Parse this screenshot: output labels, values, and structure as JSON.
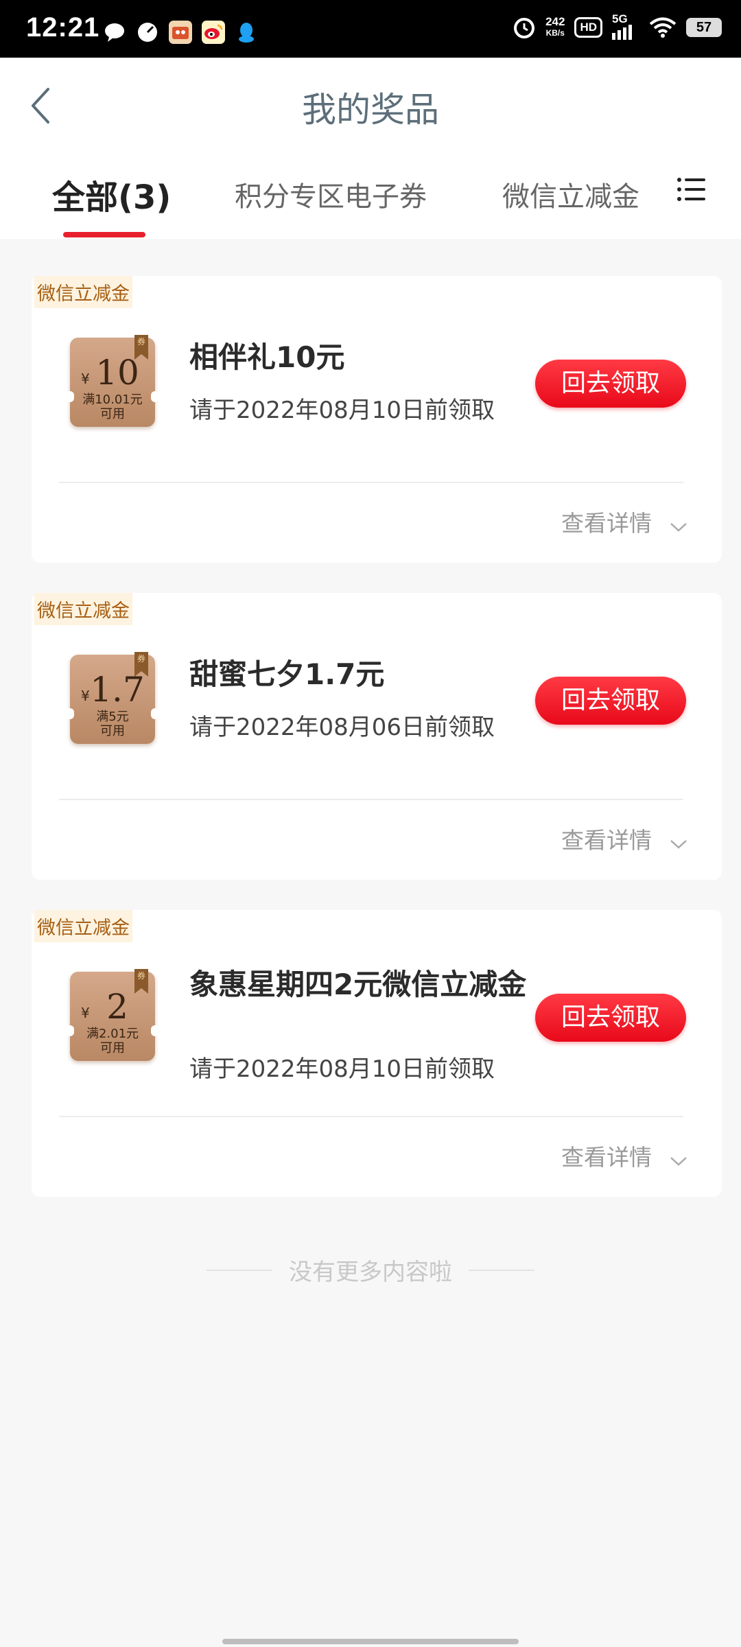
{
  "status_bar": {
    "time": "12:21",
    "speed_value": "242",
    "speed_unit": "KB/s",
    "hd": "HD",
    "network": "5G",
    "battery": "57"
  },
  "header": {
    "title": "我的奖品"
  },
  "tabs": [
    {
      "label": "全部(3)"
    },
    {
      "label": "积分专区电子券"
    },
    {
      "label": "微信立减金("
    }
  ],
  "prizes": [
    {
      "tag": "微信立减金",
      "coupon": {
        "currency": "¥",
        "amount": "10",
        "condition_line1": "满10.01元",
        "condition_line2": "可用",
        "ribbon": "券"
      },
      "name": "相伴礼10元",
      "deadline": "请于2022年08月10日前领取",
      "claim_label": "回去领取",
      "details_label": "查看详情"
    },
    {
      "tag": "微信立减金",
      "coupon": {
        "currency": "¥",
        "amount": "1.7",
        "condition_line1": "满5元",
        "condition_line2": "可用",
        "ribbon": "券"
      },
      "name": "甜蜜七夕1.7元",
      "deadline": "请于2022年08月06日前领取",
      "claim_label": "回去领取",
      "details_label": "查看详情"
    },
    {
      "tag": "微信立减金",
      "coupon": {
        "currency": "¥",
        "amount": "2",
        "condition_line1": "满2.01元",
        "condition_line2": "可用",
        "ribbon": "券"
      },
      "name": "象惠星期四2元微信立减金",
      "deadline": "请于2022年08月10日前领取",
      "claim_label": "回去领取",
      "details_label": "查看详情"
    }
  ],
  "footer": {
    "no_more": "没有更多内容啦"
  },
  "colors": {
    "accent_red": "#e8202e",
    "tag_text": "#a65e13",
    "tag_bg": "#fdf3e0",
    "title_color": "#5c6e7a"
  }
}
